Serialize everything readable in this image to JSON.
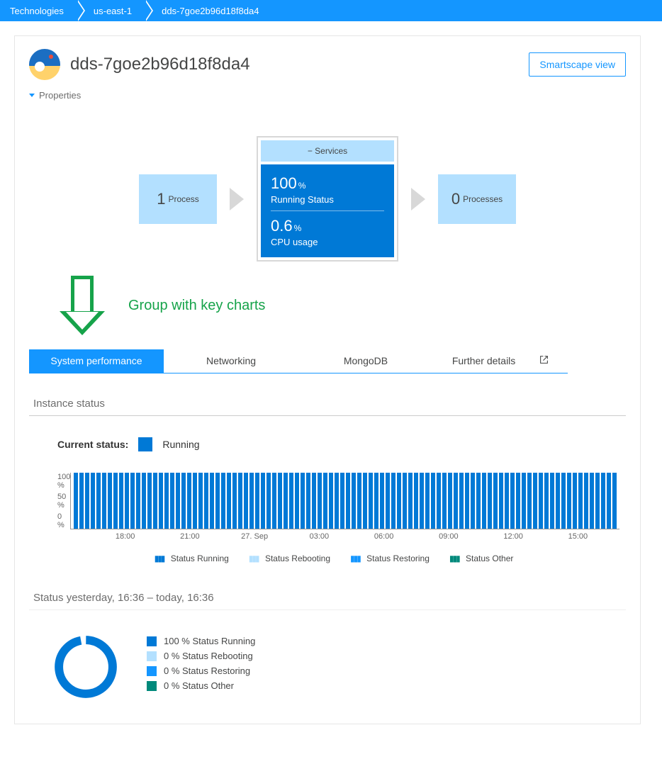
{
  "breadcrumbs": [
    "Technologies",
    "us-east-1",
    "dds-7goe2b96d18f8da4"
  ],
  "header": {
    "title": "dds-7goe2b96d18f8da4",
    "smartscape_button": "Smartscape view",
    "properties_toggle": "Properties"
  },
  "infographic": {
    "left_box": {
      "value": "1",
      "label": "Process"
    },
    "services_header": "−  Services",
    "panel": {
      "row1_value": "100",
      "row1_unit": "%",
      "row1_label": "Running Status",
      "row2_value": "0.6",
      "row2_unit": "%",
      "row2_label": "CPU usage"
    },
    "right_box": {
      "value": "0",
      "label": "Processes"
    }
  },
  "annotation": "Group with key charts",
  "tabs": [
    "System performance",
    "Networking",
    "MongoDB",
    "Further details"
  ],
  "active_tab_index": 0,
  "instance_status": {
    "section_title": "Instance status",
    "current_label": "Current status:",
    "current_value": "Running"
  },
  "chart_data": {
    "type": "bar",
    "title": "",
    "ylabel": "",
    "ylim": [
      0,
      100
    ],
    "y_ticks": [
      "100 %",
      "50 %",
      "0 %"
    ],
    "x_ticks": [
      "18:00",
      "21:00",
      "27. Sep",
      "03:00",
      "06:00",
      "09:00",
      "12:00",
      "15:00"
    ],
    "categories_note": "roughly 96 evenly-spaced 15-min buckets over 24h, all Status Running = 100",
    "series": [
      {
        "name": "Status Running",
        "color": "#0079d6",
        "values_constant": 100,
        "bucket_count": 96
      },
      {
        "name": "Status Rebooting",
        "color": "#b3e0ff",
        "values_constant": 0,
        "bucket_count": 96
      },
      {
        "name": "Status Restoring",
        "color": "#1496ff",
        "values_constant": 0,
        "bucket_count": 96
      },
      {
        "name": "Status Other",
        "color": "#00897b",
        "values_constant": 0,
        "bucket_count": 96
      }
    ]
  },
  "status_summary": {
    "title": "Status yesterday, 16:36 – today, 16:36",
    "items": [
      {
        "text": "100 % Status Running",
        "color": "#0079d6"
      },
      {
        "text": "0 % Status Rebooting",
        "color": "#b3e0ff"
      },
      {
        "text": "0 % Status Restoring",
        "color": "#1496ff"
      },
      {
        "text": "0 % Status Other",
        "color": "#00897b"
      }
    ]
  }
}
